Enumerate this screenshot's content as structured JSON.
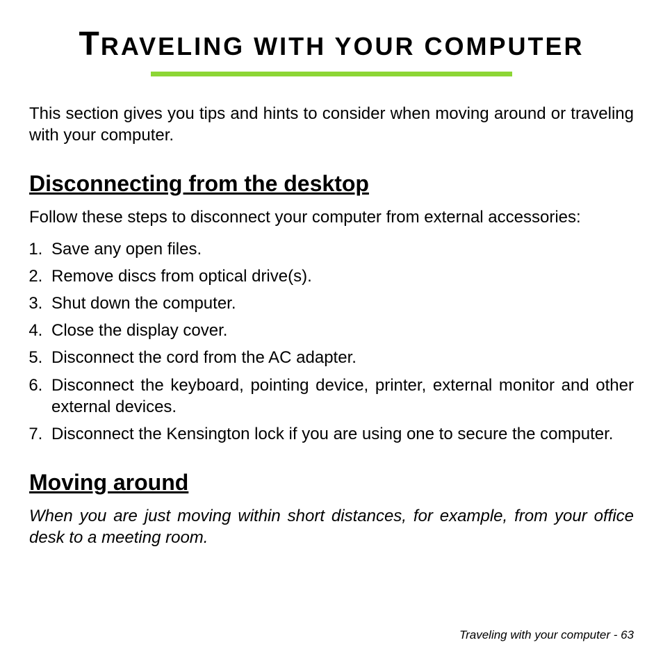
{
  "title_first": "T",
  "title_rest": "RAVELING WITH YOUR COMPUTER",
  "intro": "This section gives you tips and hints to consider when moving around or traveling with your computer.",
  "section1": {
    "heading": "Disconnecting from the desktop",
    "para": "Follow these steps to disconnect your computer from external accessories:",
    "steps": [
      "Save any open files.",
      "Remove discs from optical drive(s).",
      "Shut down the computer.",
      "Close the display cover.",
      "Disconnect the cord from the AC adapter.",
      "Disconnect the keyboard, pointing device, printer, external monitor and other external devices.",
      "Disconnect the Kensington lock if you are using one to secure the computer."
    ]
  },
  "section2": {
    "heading": "Moving around",
    "para": "When you are just moving within short distances, for example, from your office desk to a meeting room."
  },
  "footer": "Traveling with your computer -  63"
}
